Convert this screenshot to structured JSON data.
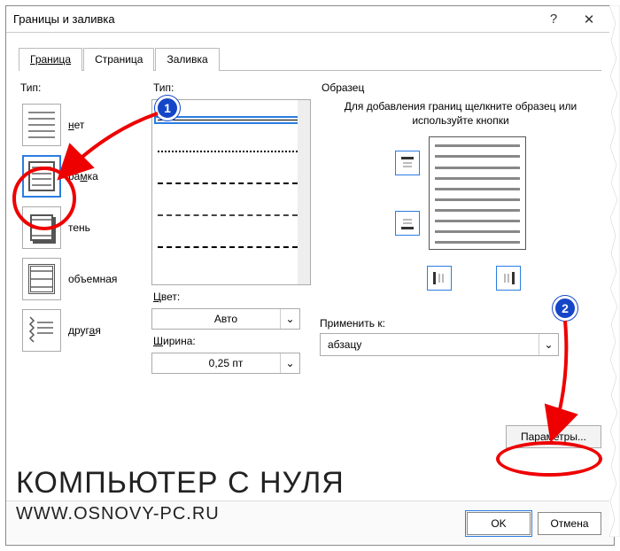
{
  "title": "Границы и заливка",
  "titlebar": {
    "help": "?",
    "close": "✕"
  },
  "tabs": {
    "border": "Граница",
    "page": "Страница",
    "fill": "Заливка"
  },
  "left": {
    "section": "Тип:",
    "items": {
      "none": "нет",
      "box": "рамка",
      "shadow": "тень",
      "threeD": "объемная",
      "custom": "другая"
    }
  },
  "mid": {
    "style_label": "Тип:",
    "color_label": "Цвет:",
    "color_value": "Авто",
    "width_label": "Ширина:",
    "width_value": "0,25 пт"
  },
  "right": {
    "section": "Образец",
    "hint": "Для добавления границ щелкните образец или используйте кнопки",
    "apply_label": "Применить к:",
    "apply_value": "абзацу",
    "params": "Параметры..."
  },
  "footer": {
    "ok": "OK",
    "cancel": "Отмена"
  },
  "annotations": {
    "badge1": "1",
    "badge2": "2"
  },
  "watermark": {
    "line1": "КОМПЬЮТЕР С НУЛЯ",
    "line2": "WWW.OSNOVY-PC.RU"
  },
  "dropdown_glyph": "⌄"
}
